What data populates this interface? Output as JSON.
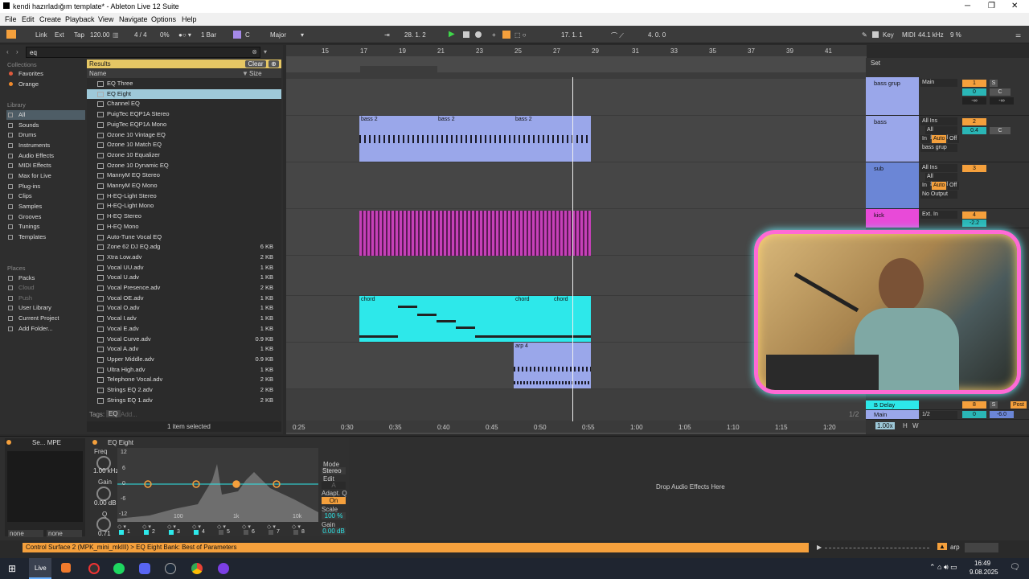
{
  "window": {
    "title": "kendi hazırladığım template* - Ableton Live 12 Suite",
    "min": "─",
    "max": "❐",
    "close": "✕"
  },
  "menu": [
    "File",
    "Edit",
    "Create",
    "Playback",
    "View",
    "Navigate",
    "Options",
    "Help"
  ],
  "control": {
    "link": "Link",
    "ext": "Ext",
    "tap": "Tap",
    "tempo": "120.00",
    "meter": "4 / 4",
    "swing": "0%",
    "quant": "1 Bar",
    "key": "C",
    "scale": "Major",
    "position": "28.  1.  2",
    "loop_start": "17.  1.  1",
    "loop_len": "4.  0.  0",
    "key_btn": "Key",
    "midi": "MIDI",
    "rate": "44.1 kHz",
    "cpu": "9 %"
  },
  "browser": {
    "search": "eq",
    "collections_label": "Collections",
    "collections": [
      {
        "label": "Favorites",
        "color": "#e05a3c"
      },
      {
        "label": "Orange",
        "color": "#f08a2c"
      }
    ],
    "library_label": "Library",
    "library": [
      "All",
      "Sounds",
      "Drums",
      "Instruments",
      "Audio Effects",
      "MIDI Effects",
      "Max for Live",
      "Plug-ins",
      "Clips",
      "Samples",
      "Grooves",
      "Tunings",
      "Templates"
    ],
    "places_label": "Places",
    "places": [
      "Packs",
      "Cloud",
      "Push",
      "User Library",
      "Current Project",
      "Add Folder..."
    ],
    "results_label": "Results",
    "clear": "Clear",
    "col_name": "Name",
    "col_size": "Size",
    "items": [
      {
        "n": "EQ Three",
        "s": ""
      },
      {
        "n": "EQ Eight",
        "s": ""
      },
      {
        "n": "Channel EQ",
        "s": ""
      },
      {
        "n": "PuigTec EQP1A Stereo",
        "s": ""
      },
      {
        "n": "PuigTec EQP1A Mono",
        "s": ""
      },
      {
        "n": "Ozone 10 Vintage EQ",
        "s": ""
      },
      {
        "n": "Ozone 10 Match EQ",
        "s": ""
      },
      {
        "n": "Ozone 10 Equalizer",
        "s": ""
      },
      {
        "n": "Ozone 10 Dynamic EQ",
        "s": ""
      },
      {
        "n": "MannyM EQ Stereo",
        "s": ""
      },
      {
        "n": "MannyM EQ Mono",
        "s": ""
      },
      {
        "n": "H-EQ-Light Stereo",
        "s": ""
      },
      {
        "n": "H-EQ-Light Mono",
        "s": ""
      },
      {
        "n": "H-EQ Stereo",
        "s": ""
      },
      {
        "n": "H-EQ Mono",
        "s": ""
      },
      {
        "n": "Auto-Tune Vocal EQ",
        "s": ""
      },
      {
        "n": "Zone 62 DJ EQ.adg",
        "s": "6 KB"
      },
      {
        "n": "Xtra Low.adv",
        "s": "2 KB"
      },
      {
        "n": "Vocal UU.adv",
        "s": "1 KB"
      },
      {
        "n": "Vocal U.adv",
        "s": "1 KB"
      },
      {
        "n": "Vocal Presence.adv",
        "s": "2 KB"
      },
      {
        "n": "Vocal OE.adv",
        "s": "1 KB"
      },
      {
        "n": "Vocal O.adv",
        "s": "1 KB"
      },
      {
        "n": "Vocal I.adv",
        "s": "1 KB"
      },
      {
        "n": "Vocal E.adv",
        "s": "1 KB"
      },
      {
        "n": "Vocal Curve.adv",
        "s": "0.9 KB"
      },
      {
        "n": "Vocal A.adv",
        "s": "1 KB"
      },
      {
        "n": "Upper Middle.adv",
        "s": "0.9 KB"
      },
      {
        "n": "Ultra High.adv",
        "s": "1 KB"
      },
      {
        "n": "Telephone Vocal.adv",
        "s": "2 KB"
      },
      {
        "n": "Strings EQ 2.adv",
        "s": "2 KB"
      },
      {
        "n": "Strings EQ 1.adv",
        "s": "2 KB"
      }
    ],
    "tags": "Tags:",
    "tag_eq": "EQ",
    "tag_add": "Add...",
    "selected": "1 item selected"
  },
  "arrangement": {
    "bars": [
      "15",
      "17",
      "19",
      "21",
      "23",
      "25",
      "27",
      "29",
      "31",
      "33",
      "35",
      "37",
      "39",
      "41"
    ],
    "times": [
      "0:25",
      "0:30",
      "0:35",
      "0:40",
      "0:45",
      "0:50",
      "0:55",
      "1:00",
      "1:05",
      "1:10",
      "1:15",
      "1:20"
    ],
    "clips": {
      "bass": [
        "bass 2",
        "bass 2",
        "bass 2"
      ],
      "chord": [
        "chord",
        "chord",
        "chord"
      ],
      "arp": "arp 4"
    },
    "page": "1/2"
  },
  "mixer": {
    "set": "Set",
    "tracks": [
      {
        "name": "bass grup",
        "in": "Main",
        "n": "1",
        "vol": "0",
        "pan": "C",
        "color": "#9aa7ea"
      },
      {
        "name": "bass",
        "in": "All Ins",
        "ch": "All Channels",
        "out": "bass grup",
        "n": "2",
        "vol": "0.4",
        "pan": "C",
        "color": "#9aa7ea"
      },
      {
        "name": "sub",
        "in": "All Ins",
        "ch": "All Channels",
        "out": "No Output",
        "n": "3",
        "color": "#6b86d6"
      },
      {
        "name": "kick",
        "in": "Ext. In",
        "n": "4",
        "vol": "-2.2",
        "color": "#e84ad8"
      }
    ],
    "in_lbl": "In",
    "auto_lbl": "Auto",
    "off_lbl": "Off",
    "inf": "-∞",
    "delay": "B Delay",
    "delay_n": "8",
    "main": "Main",
    "main_out": "1/2",
    "main_vol": "0",
    "main_db": "-6.0",
    "zoom": "1.00x",
    "h": "H",
    "w": "W",
    "s": "S",
    "post": "Post"
  },
  "device": {
    "left_title": "Se... MPE",
    "none1": "none",
    "none2": "none",
    "title": "EQ Eight",
    "freq_lbl": "Freq",
    "freq": "1.00 kHz",
    "gain_lbl": "Gain",
    "gain": "0.00 dB",
    "q_lbl": "Q",
    "q": "0.71",
    "db_ticks": [
      "12",
      "6",
      "0",
      "-6",
      "-12"
    ],
    "hz_ticks": [
      "100",
      "1k",
      "10k"
    ],
    "mode_lbl": "Mode",
    "mode": "Stereo",
    "edit_lbl": "Edit",
    "edit": "A",
    "adapt_lbl": "Adapt. Q",
    "adapt": "On",
    "scale_lbl": "Scale",
    "scale": "100 %",
    "gainout_lbl": "Gain",
    "gainout": "0.00 dB",
    "bands": [
      "1",
      "2",
      "3",
      "4",
      "5",
      "6",
      "7",
      "8"
    ],
    "drop": "Drop Audio Effects Here"
  },
  "status": {
    "text": "Control Surface 2 (MPK_mini_mkIII) > EQ Eight Bank: Best of Parameters",
    "track": "arp"
  },
  "taskbar": {
    "live": "Live",
    "time": "16:49",
    "date": "9.08.2025"
  },
  "colors": {
    "accent": "#f5a03c",
    "clip_blue": "#9aa7ea",
    "clip_pink": "#c640b8",
    "clip_cyan": "#2de8ea",
    "sel": "#9ec9d9"
  }
}
